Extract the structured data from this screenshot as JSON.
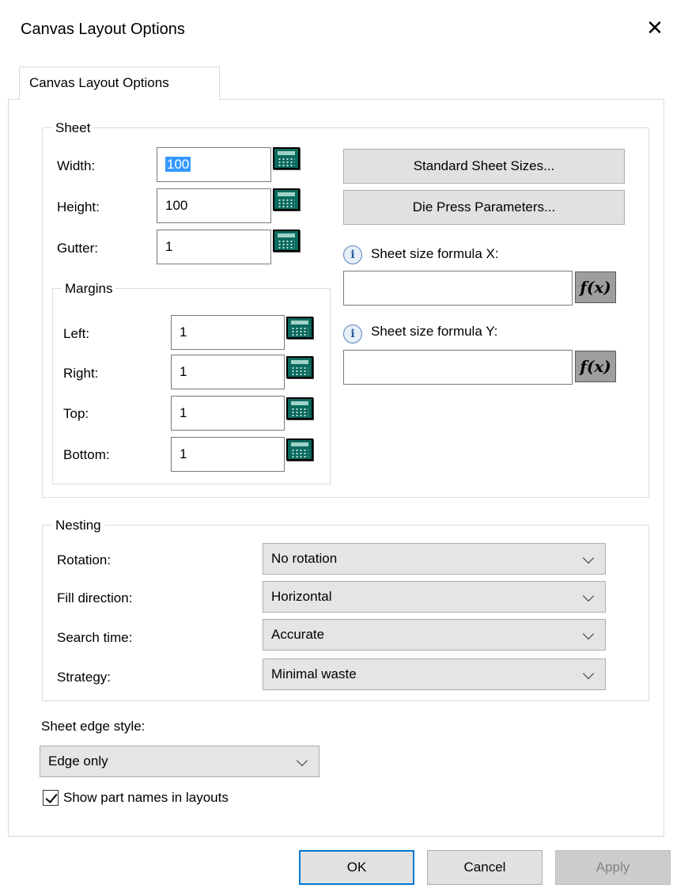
{
  "window": {
    "title": "Canvas Layout Options",
    "close": "✕"
  },
  "tab": {
    "label": "Canvas Layout Options"
  },
  "sheet": {
    "legend": "Sheet",
    "width": {
      "label": "Width:",
      "value": "100"
    },
    "height": {
      "label": "Height:",
      "value": "100"
    },
    "gutter": {
      "label": "Gutter:",
      "value": "1"
    },
    "standard_sizes_button": "Standard Sheet Sizes...",
    "die_press_button": "Die Press Parameters...",
    "formula_x": {
      "label": "Sheet size formula X:",
      "value": "",
      "fx": "f(x)"
    },
    "formula_y": {
      "label": "Sheet size formula Y:",
      "value": "",
      "fx": "f(x)"
    },
    "info_glyph": "i"
  },
  "margins": {
    "legend": "Margins",
    "left": {
      "label": "Left:",
      "value": "1"
    },
    "right": {
      "label": "Right:",
      "value": "1"
    },
    "top": {
      "label": "Top:",
      "value": "1"
    },
    "bottom": {
      "label": "Bottom:",
      "value": "1"
    }
  },
  "nesting": {
    "legend": "Nesting",
    "rotation": {
      "label": "Rotation:",
      "value": "No rotation"
    },
    "fill_direction": {
      "label": "Fill direction:",
      "value": "Horizontal"
    },
    "search_time": {
      "label": "Search time:",
      "value": "Accurate"
    },
    "strategy": {
      "label": "Strategy:",
      "value": "Minimal waste"
    }
  },
  "edge_style": {
    "label": "Sheet edge style:",
    "value": "Edge only"
  },
  "show_part_names": {
    "label": "Show part names in layouts",
    "checked": true
  },
  "footer": {
    "ok": "OK",
    "cancel": "Cancel",
    "apply": "Apply"
  },
  "icons": {
    "calculator": "calculator-icon",
    "info": "info-icon",
    "formula": "function-icon",
    "dropdown": "chevron-down-icon",
    "close": "close-icon",
    "check": "checkbox"
  },
  "colors": {
    "selection": "#3399ff",
    "ok_border": "#0078d7",
    "calculator": "#0b6a5e",
    "button_face": "#e1e1e1"
  }
}
